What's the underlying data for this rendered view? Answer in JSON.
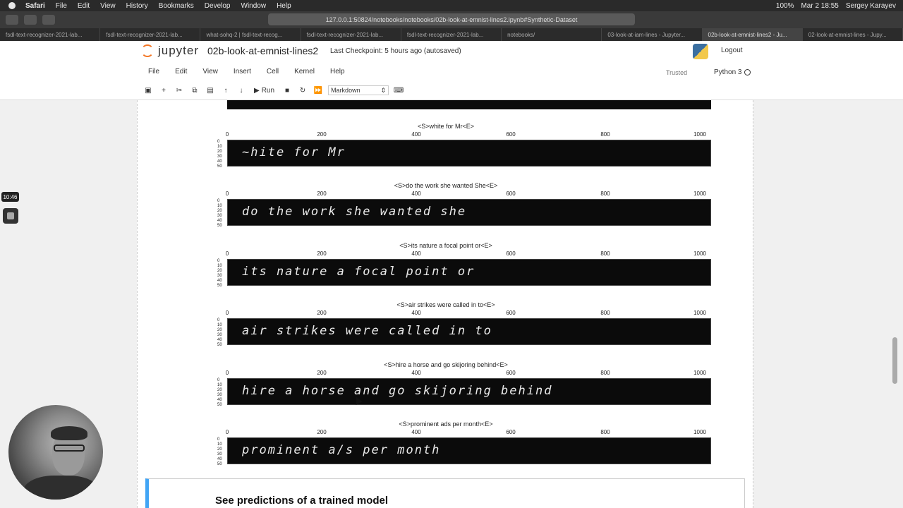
{
  "mac_menubar": {
    "app": "Safari",
    "items": [
      "File",
      "Edit",
      "View",
      "History",
      "Bookmarks",
      "Develop",
      "Window",
      "Help"
    ],
    "battery": "100%",
    "datetime": "Mar 2  18:55",
    "user": "Sergey Karayev"
  },
  "browser": {
    "url": "127.0.0.1:50824/notebooks/notebooks/02b-look-at-emnist-lines2.ipynb#Synthetic-Dataset",
    "tabs": [
      "fsdl-text-recognizer-2021-lab...",
      "fsdl-text-recognizer-2021-lab...",
      "what-sohq-2 | fsdl-text-recog...",
      "fsdl-text-recognizer-2021-lab...",
      "fsdl-text-recognizer-2021-lab...",
      "notebooks/",
      "03-look-at-iam-lines - Jupyter...",
      "02b-look-at-emnist-lines2 - Ju...",
      "02-look-at-emnist-lines - Jupy..."
    ],
    "active_tab_index": 7
  },
  "jupyter": {
    "logo_text": "jupyter",
    "notebook_name": "02b-look-at-emnist-lines2",
    "checkpoint": "Last Checkpoint: 5 hours ago  (autosaved)",
    "logout": "Logout",
    "menu": [
      "File",
      "Edit",
      "View",
      "Insert",
      "Cell",
      "Kernel",
      "Help"
    ],
    "trusted": "Trusted",
    "kernel": "Python 3",
    "run_label": "Run",
    "cell_type": "Markdown"
  },
  "plots": [
    {
      "title": "<S>white for Mr<E>",
      "handwriting": "~hite for Mr"
    },
    {
      "title": "<S>do the work she wanted She<E>",
      "handwriting": "do the work she wanted she"
    },
    {
      "title": "<S>its nature a focal point or<E>",
      "handwriting": "its nature a focal point or"
    },
    {
      "title": "<S>air strikes were called in to<E>",
      "handwriting": "air strikes were called in to"
    },
    {
      "title": "<S>hire a horse and go skijoring behind<E>",
      "handwriting": "hire a horse and go skijoring behind"
    },
    {
      "title": "<S>prominent ads per month<E>",
      "handwriting": "prominent a/s per month"
    }
  ],
  "x_ticks": [
    "0",
    "200",
    "400",
    "600",
    "800",
    "1000"
  ],
  "y_ticks": [
    "0",
    "10",
    "20",
    "30",
    "40",
    "50"
  ],
  "markdown_heading": "See predictions of a trained model",
  "overlay": {
    "timestamp": "10:46"
  }
}
